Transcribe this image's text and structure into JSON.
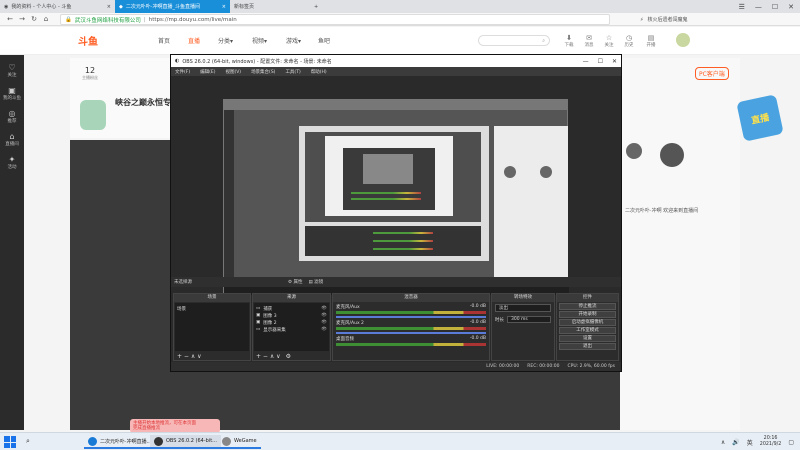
{
  "browser": {
    "tabs": [
      {
        "label": "我的资料 - 个人中心 - 斗鱼",
        "active": false
      },
      {
        "label": "二次元卟卟·冲啊直播_斗鱼直播间",
        "active": true
      },
      {
        "label": "新标签页",
        "active": false
      }
    ],
    "new_tab": "+",
    "address": {
      "site": "武汉斗鱼网络科技有限公司",
      "sep": "|",
      "url": "https://mp.douyu.com/live/main"
    },
    "right_text": "核火后遗者闯魔鬼",
    "window_controls": [
      "☰",
      "—",
      "☐",
      "✕"
    ]
  },
  "site": {
    "logo": "斗鱼",
    "nav": [
      {
        "label": "首页",
        "active": false
      },
      {
        "label": "直播",
        "active": true
      },
      {
        "label": "分类▾",
        "active": false
      },
      {
        "label": "视频▾",
        "active": false
      },
      {
        "label": "游戏▾",
        "active": false
      },
      {
        "label": "鱼吧",
        "active": false
      }
    ],
    "header_icons": [
      {
        "icon": "⬇",
        "label": "下载"
      },
      {
        "icon": "✉",
        "label": "消息"
      },
      {
        "icon": "☆",
        "label": "关注"
      },
      {
        "icon": "◷",
        "label": "历史"
      },
      {
        "icon": "▤",
        "label": "开播"
      }
    ],
    "sidebar": [
      {
        "icon": "♡",
        "label": "关注"
      },
      {
        "icon": "▣",
        "label": "我的斗鱼"
      },
      {
        "icon": "◎",
        "label": "推荐"
      },
      {
        "icon": "⌂",
        "label": "直播间"
      },
      {
        "icon": "✦",
        "label": "活动"
      }
    ],
    "follow_count": "12",
    "follow_label": "主播粉丝",
    "room_title": "峡谷之巅永恒专场",
    "pc_badge": "PC客户端",
    "promo": "直播",
    "notice": "二次元卟卟·冲啊  欢迎来到直播间"
  },
  "obs": {
    "title": "OBS 26.0.2 (64-bit, windows) - 配置文件: 未命名 - 场景: 未命名",
    "window_controls": [
      "—",
      "☐",
      "✕"
    ],
    "menu": [
      "文件(F)",
      "编辑(E)",
      "视图(V)",
      "场景集合(S)",
      "工具(T)",
      "帮助(H)"
    ],
    "status_top": {
      "selected": "未选择源",
      "props": "⚙ 属性",
      "filters": "▤ 滤镜"
    },
    "docks": {
      "scenes": {
        "title": "场景",
        "items": [
          "场景"
        ]
      },
      "sources": {
        "title": "来源",
        "items": [
          "捕获",
          "图像 3",
          "图像 2",
          "显示器采集"
        ]
      },
      "mixer": {
        "title": "混音器",
        "rows": [
          {
            "name": "麦克风/Aux",
            "value": "-0.0 dB"
          },
          {
            "name": "麦克风/Aux 2",
            "value": "-0.0 dB"
          },
          {
            "name": "桌面音频",
            "value": "-0.0 dB"
          }
        ]
      },
      "transitions": {
        "title": "转场特效",
        "type": "淡出",
        "duration_label": "时长",
        "duration": "300 ms"
      },
      "controls": {
        "title": "控件",
        "buttons": [
          "停止推流",
          "开始录制",
          "启动虚拟摄像机",
          "工作室模式",
          "设置",
          "退出"
        ]
      }
    },
    "dock_footer": "+ − ∧ ∨",
    "status_bottom": [
      "LIVE: 00:00:00",
      "REC: 00:00:00",
      "CPU: 2.9%, 60.00 fps"
    ]
  },
  "toast": {
    "line1": "主播开始本地推流，可在本页面",
    "line2": "完成直播推流"
  },
  "taskbar": {
    "apps": [
      {
        "label": "二次元卟卟·冲啊直播...",
        "color": "#1a7bd6"
      },
      {
        "label": "OBS 26.0.2 (64-bit...",
        "color": "#333333"
      },
      {
        "label": "WeGame",
        "color": "#888888"
      }
    ],
    "tray": [
      "∧",
      "🔊",
      "英"
    ],
    "time": "20:16",
    "date": "2021/9/2"
  }
}
